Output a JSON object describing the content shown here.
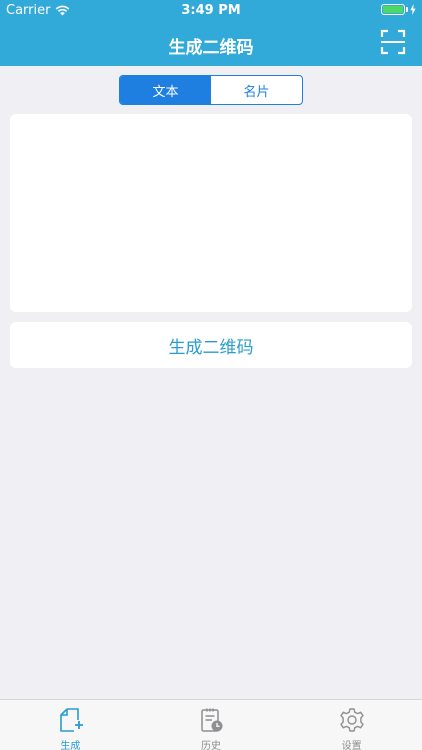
{
  "status_bar": {
    "carrier": "Carrier",
    "time": "3:49 PM"
  },
  "nav": {
    "title": "生成二维码"
  },
  "segments": [
    {
      "label": "文本",
      "selected": true
    },
    {
      "label": "名片",
      "selected": false
    }
  ],
  "text_input": {
    "value": "",
    "placeholder": ""
  },
  "generate_button": {
    "label": "生成二维码"
  },
  "tab_bar": {
    "items": [
      {
        "label": "生成",
        "icon": "new-document-icon",
        "active": true
      },
      {
        "label": "历史",
        "icon": "history-clipboard-icon",
        "active": false
      },
      {
        "label": "设置",
        "icon": "gear-icon",
        "active": false
      }
    ]
  },
  "colors": {
    "header": "#31a9d9",
    "accent": "#2a9ccf",
    "segment": "#1f7fe0",
    "background": "#efeff4",
    "battery_fill": "#4cd964"
  }
}
